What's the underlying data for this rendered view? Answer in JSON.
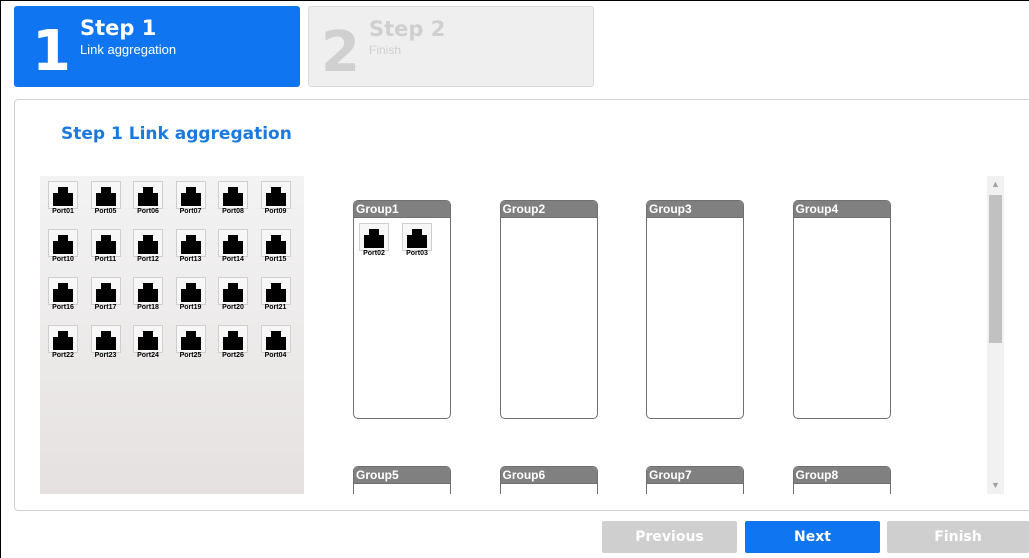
{
  "steps": [
    {
      "number": "1",
      "title": "Step 1",
      "subtitle": "Link aggregation"
    },
    {
      "number": "2",
      "title": "Step 2",
      "subtitle": "Finish"
    }
  ],
  "panel": {
    "title": "Step 1 Link aggregation"
  },
  "pool_ports": [
    "Port01",
    "Port05",
    "Port06",
    "Port07",
    "Port08",
    "Port09",
    "Port10",
    "Port11",
    "Port12",
    "Port13",
    "Port14",
    "Port15",
    "Port16",
    "Port17",
    "Port18",
    "Port19",
    "Port20",
    "Port21",
    "Port22",
    "Port23",
    "Port24",
    "Port25",
    "Port26",
    "Port04"
  ],
  "groups": [
    {
      "name": "Group1",
      "ports": [
        "Port02",
        "Port03"
      ]
    },
    {
      "name": "Group2",
      "ports": []
    },
    {
      "name": "Group3",
      "ports": []
    },
    {
      "name": "Group4",
      "ports": []
    },
    {
      "name": "Group5",
      "ports": []
    },
    {
      "name": "Group6",
      "ports": []
    },
    {
      "name": "Group7",
      "ports": []
    },
    {
      "name": "Group8",
      "ports": []
    }
  ],
  "icons": {
    "port": "ethernet-port-icon",
    "scroll_up": "scroll-up-arrow-icon",
    "scroll_down": "scroll-down-arrow-icon"
  },
  "buttons": {
    "previous": "Previous",
    "next": "Next",
    "finish": "Finish"
  },
  "colors": {
    "accent": "#0f75f0",
    "title": "#1a7ae0",
    "disabled": "#cfcfcf",
    "group_header": "#808080"
  }
}
